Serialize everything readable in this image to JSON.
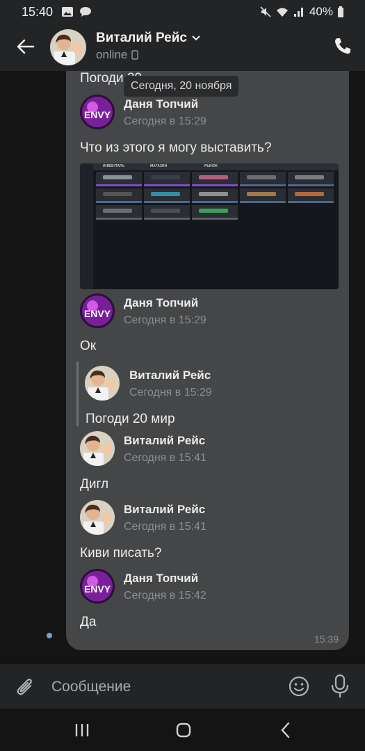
{
  "status_bar": {
    "time": "15:40",
    "battery": "40%"
  },
  "header": {
    "name": "Виталий Рейс",
    "status": "online"
  },
  "chat": {
    "date_tooltip": "Сегодня, 20 ноября",
    "bubble_time": "15:39",
    "messages": [
      {
        "text": "Погоди 20"
      },
      {
        "sender": "Даня Топчий",
        "time": "Сегодня в 15:29",
        "text": "Что из этого я могу выставить?"
      },
      {
        "sender": "Даня Топчий",
        "time": "Сегодня в 15:29",
        "text": "Ок"
      },
      {
        "sender": "Виталий Рейс",
        "time": "Сегодня в 15:29",
        "text": "Погоди 20 мир",
        "forwarded": true
      },
      {
        "sender": "Виталий Рейс",
        "time": "Сегодня в 15:41",
        "text": "Дигл"
      },
      {
        "sender": "Виталий Рейс",
        "time": "Сегодня в 15:41",
        "text": "Киви писать?"
      },
      {
        "sender": "Даня Топчий",
        "time": "Сегодня в 15:42",
        "text": "Да"
      }
    ],
    "attachment": {
      "tabs": [
        "ИНВЕНТАРЬ",
        "МАГАЗИН",
        "РЫНОК"
      ]
    }
  },
  "input": {
    "placeholder": "Сообщение"
  },
  "colors": {
    "header_bg": "#232426",
    "bubble_bg": "#454647",
    "chat_bg": "#141414",
    "accent": "#6fa3d6"
  },
  "icons": [
    "back-arrow-icon",
    "phone-icon",
    "chevron-down-icon",
    "mobile-icon",
    "paperclip-icon",
    "emoji-icon",
    "microphone-icon",
    "recents-icon",
    "home-icon",
    "nav-back-icon"
  ]
}
